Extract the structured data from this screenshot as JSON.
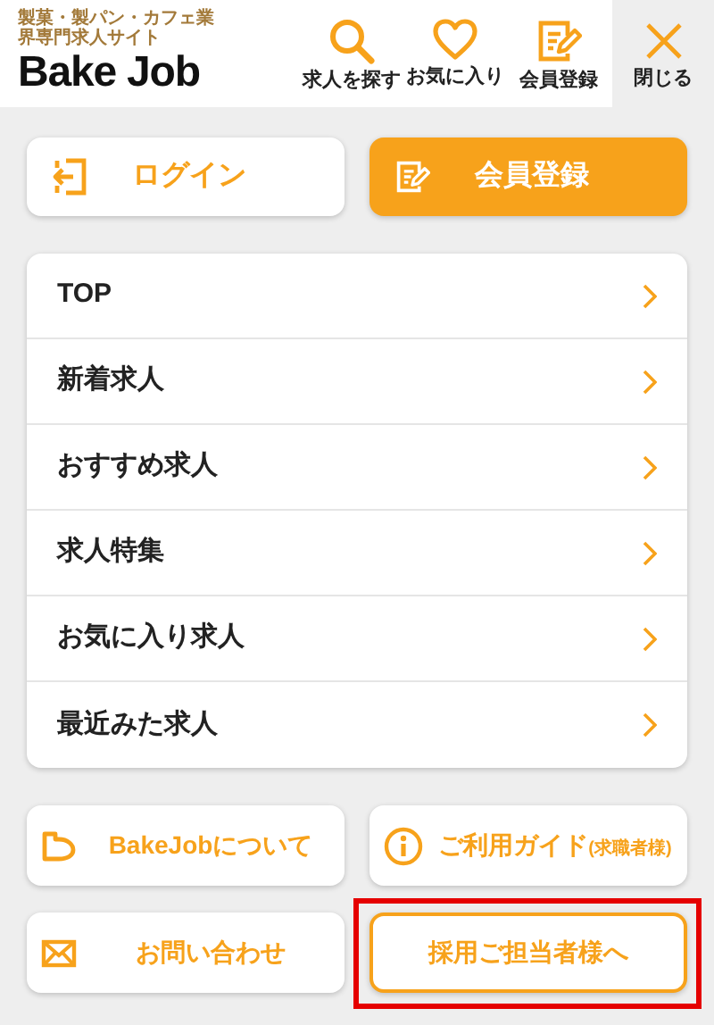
{
  "header": {
    "tagline": "製菓・製パン・カフェ業界専門求人サイト",
    "logo": "Bake Job",
    "actions": [
      {
        "kind": "search",
        "label": "求人を探す"
      },
      {
        "kind": "heart",
        "label": "お気に入り"
      },
      {
        "kind": "edit",
        "label": "会員登録"
      }
    ],
    "close": {
      "label": "閉じる"
    }
  },
  "auth_buttons": [
    {
      "kind": "login",
      "label": "ログイン"
    },
    {
      "kind": "register",
      "label": "会員登録"
    }
  ],
  "menu": [
    {
      "label": "TOP"
    },
    {
      "label": "新着求人"
    },
    {
      "label": "おすすめ求人"
    },
    {
      "label": "求人特集"
    },
    {
      "label": "お気に入り求人"
    },
    {
      "label": "最近みた求人"
    }
  ],
  "links": [
    {
      "kind": "about",
      "label": "BakeJobについて",
      "highlighted": false
    },
    {
      "kind": "guide",
      "label": "ご利用ガイド",
      "note": "(求職者様)",
      "highlighted": false
    },
    {
      "kind": "contact",
      "label": "お問い合わせ",
      "highlighted": false
    },
    {
      "kind": "employer",
      "label": "採用ご担当者様へ",
      "highlighted": true
    }
  ]
}
